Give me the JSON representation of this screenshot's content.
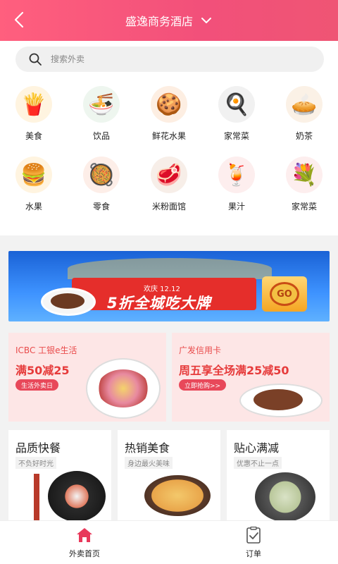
{
  "header": {
    "title": "盛逸商务酒店"
  },
  "search": {
    "placeholder": "搜索外卖"
  },
  "categories": [
    {
      "label": "美食",
      "icon": "fries-icon",
      "glyph": "🍟",
      "color": "#fff4e0"
    },
    {
      "label": "饮品",
      "icon": "bowl-icon",
      "glyph": "🍜",
      "color": "#eef6ef"
    },
    {
      "label": "鲜花水果",
      "icon": "cookie-icon",
      "glyph": "🍪",
      "color": "#fdeee2"
    },
    {
      "label": "家常菜",
      "icon": "pan-icon",
      "glyph": "🍳",
      "color": "#f1f1f1"
    },
    {
      "label": "奶茶",
      "icon": "pie-icon",
      "glyph": "🥧",
      "color": "#fbf1e6"
    },
    {
      "label": "水果",
      "icon": "burger-icon",
      "glyph": "🍔",
      "color": "#fff4e0"
    },
    {
      "label": "零食",
      "icon": "hotpot-icon",
      "glyph": "🥘",
      "color": "#fdeee8"
    },
    {
      "label": "米粉面馆",
      "icon": "steak-icon",
      "glyph": "🥩",
      "color": "#f7eee8"
    },
    {
      "label": "果汁",
      "icon": "drink-icon",
      "glyph": "🍹",
      "color": "#fdeeee"
    },
    {
      "label": "家常菜",
      "icon": "flowers-icon",
      "glyph": "💐",
      "color": "#fdeeee"
    }
  ],
  "banner": {
    "subtitle": "欢庆 12.12",
    "headline": "5折全城吃大牌",
    "cta": "GO"
  },
  "promos": [
    {
      "line1": "ICBC 工银e生活",
      "line2": "满50减25",
      "pill": "生活外卖日"
    },
    {
      "line1": "广发信用卡",
      "line2": "周五享全场满25减50",
      "pill": "立即抢购>>"
    }
  ],
  "tiles": [
    {
      "title": "品质快餐",
      "subtitle": "不负好时光"
    },
    {
      "title": "热销美食",
      "subtitle": "身边最火美味"
    },
    {
      "title": "贴心满减",
      "subtitle": "优惠不止一点"
    }
  ],
  "tabbar": [
    {
      "label": "外卖首页",
      "icon": "home-icon",
      "active": true
    },
    {
      "label": "订单",
      "icon": "order-icon",
      "active": false
    }
  ],
  "colors": {
    "brand": "#f2507a",
    "accent": "#e63b3b"
  }
}
